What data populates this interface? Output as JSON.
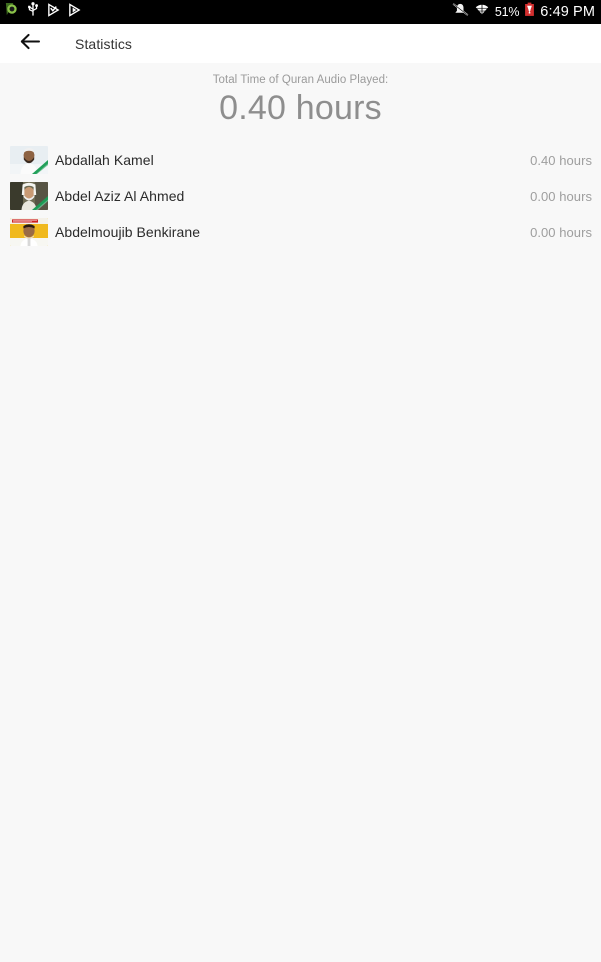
{
  "status_bar": {
    "left_icons": [
      "app-logo-icon",
      "usb-icon",
      "play-store-beta-icon",
      "play-store-icon"
    ],
    "silent_icon": "mute-bell-icon",
    "wifi_icon": "wifi-icon",
    "battery_percent": "51%",
    "battery_icon": "battery-alert-icon",
    "clock": "6:49 PM"
  },
  "toolbar": {
    "back_icon": "back-arrow-icon",
    "title": "Statistics"
  },
  "summary": {
    "label": "Total Time of Quran Audio Played:",
    "value": "0.40 hours"
  },
  "reciters": [
    {
      "name": "Abdallah Kamel",
      "duration": "0.40 hours",
      "avatar": "reciter-photo-1"
    },
    {
      "name": "Abdel Aziz Al Ahmed",
      "duration": "0.00 hours",
      "avatar": "reciter-photo-2"
    },
    {
      "name": "Abdelmoujib Benkirane",
      "duration": "0.00 hours",
      "avatar": "reciter-photo-3"
    }
  ],
  "colors": {
    "status_bar_bg": "#000000",
    "toolbar_bg": "#ffffff",
    "page_bg": "#f8f8f8",
    "summary_value": "#8e8e8e",
    "summary_label": "#9b9b9b",
    "name_text": "#2b2b2b",
    "duration_text": "#9e9e9e",
    "battery_red": "#d32f2f",
    "logo_green": "#6aa728"
  }
}
